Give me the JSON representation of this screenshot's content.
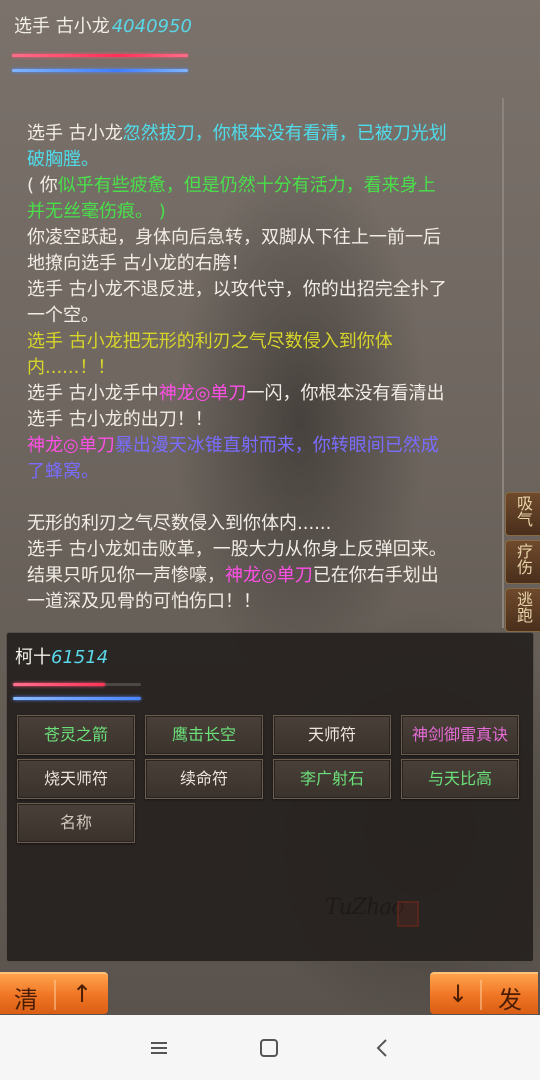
{
  "opponent": {
    "name": "选手 古小龙",
    "hp": "4040950"
  },
  "log": [
    [
      {
        "t": "选手 古小龙",
        "c": "white"
      },
      {
        "t": "忽然拔刀，你根本没有看清，已被刀光划",
        "c": "cyan"
      }
    ],
    [
      {
        "t": "破胸膛。",
        "c": "cyan"
      }
    ],
    [
      {
        "t": "( 你",
        "c": "white"
      },
      {
        "t": "似乎有些疲惫，但是仍然十分有活力，看来身上",
        "c": "green"
      }
    ],
    [
      {
        "t": "并无丝毫伤痕。 )",
        "c": "green"
      }
    ],
    [
      {
        "t": "你凌空跃起，身体向后急转，双脚从下往上一前一后",
        "c": "white"
      }
    ],
    [
      {
        "t": "地撩向选手 古小龙的右胯！",
        "c": "white"
      }
    ],
    [
      {
        "t": "选手 古小龙不退反进，以攻代守，你的出招完全扑了",
        "c": "white"
      }
    ],
    [
      {
        "t": "一个空。",
        "c": "white"
      }
    ],
    [
      {
        "t": "选手 古小龙把无形的利刃之气尽数侵入到你体",
        "c": "yellow"
      }
    ],
    [
      {
        "t": "内......！！",
        "c": "yellow"
      }
    ],
    [
      {
        "t": "选手 古小龙手中",
        "c": "white"
      },
      {
        "t": "神龙◎单刀",
        "c": "magenta"
      },
      {
        "t": "一闪，你根本没有看清出",
        "c": "white"
      }
    ],
    [
      {
        "t": "选手 古小龙的出刀！！",
        "c": "white"
      }
    ],
    [
      {
        "t": "神龙◎单刀",
        "c": "magenta"
      },
      {
        "t": "暴出漫天冰锥直射而来，你转眼间已然成",
        "c": "purple"
      }
    ],
    [
      {
        "t": "了蜂窝。",
        "c": "purple"
      }
    ],
    [],
    [
      {
        "t": "无形的利刃之气尽数侵入到你体内......",
        "c": "white"
      }
    ],
    [
      {
        "t": "选手 古小龙如击败革，一股大力从你身上反弹回来。",
        "c": "white"
      }
    ],
    [
      {
        "t": "结果只听见你一声惨嚎，",
        "c": "white"
      },
      {
        "t": "神龙◎单刀",
        "c": "magenta"
      },
      {
        "t": "已在你右手划出",
        "c": "white"
      }
    ],
    [
      {
        "t": "一道深及见骨的可怕伤口！！",
        "c": "white"
      }
    ]
  ],
  "side_actions": [
    "吸气",
    "疗伤",
    "逃跑"
  ],
  "player": {
    "name": "柯十",
    "hp": "61514",
    "hp_fraction": 0.72
  },
  "skills": [
    {
      "label": "苍灵之箭",
      "c": "green"
    },
    {
      "label": "鹰击长空",
      "c": "green"
    },
    {
      "label": "天师符",
      "c": "white"
    },
    {
      "label": "神剑御雷真诀",
      "c": "pink"
    },
    {
      "label": "烧天师符",
      "c": "white"
    },
    {
      "label": "续命符",
      "c": "white"
    },
    {
      "label": "李广射石",
      "c": "green"
    },
    {
      "label": "与天比高",
      "c": "green"
    },
    {
      "label": "名称",
      "c": "gray"
    }
  ],
  "bottom": {
    "clear_label": "清",
    "up_label": "↑",
    "down_label": "↓",
    "send_label": "发"
  },
  "colors": {
    "accent_orange": "#ef7424",
    "hp_red": "#ff3355",
    "mp_blue": "#4a84ff",
    "name_cyan": "#59d7e8"
  }
}
